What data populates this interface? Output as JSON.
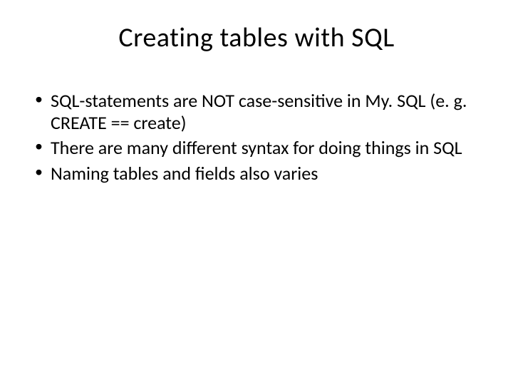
{
  "title": "Creating tables with SQL",
  "bullets": [
    "SQL-statements are NOT case-sensitive in My. SQL (e. g. CREATE == create)",
    "There are many different syntax for doing things in SQL",
    "Naming tables and fields also varies"
  ]
}
